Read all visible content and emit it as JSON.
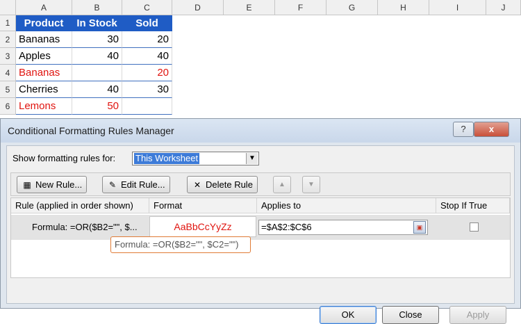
{
  "sheet": {
    "columns": [
      "A",
      "B",
      "C",
      "D",
      "E",
      "F",
      "G",
      "H",
      "I",
      "J"
    ],
    "rows": [
      "1",
      "2",
      "3",
      "4",
      "5",
      "6"
    ],
    "header": {
      "product": "Product",
      "instock": "In Stock",
      "sold": "Sold"
    },
    "data": [
      {
        "product": "Bananas",
        "instock": "30",
        "sold": "20"
      },
      {
        "product": "Apples",
        "instock": "40",
        "sold": "40"
      },
      {
        "product": "Bananas",
        "instock": "",
        "sold": "20"
      },
      {
        "product": "Cherries",
        "instock": "40",
        "sold": "30"
      },
      {
        "product": "Lemons",
        "instock": "50",
        "sold": ""
      }
    ]
  },
  "dialog": {
    "title": "Conditional Formatting Rules Manager",
    "help_label": "?",
    "close_label": "x",
    "show_label": "Show formatting rules for:",
    "show_value": "This Worksheet",
    "toolbar": {
      "new_rule": "New Rule...",
      "edit_rule": "Edit Rule...",
      "delete_rule": "Delete Rule"
    },
    "columns": {
      "rule": "Rule (applied in order shown)",
      "format": "Format",
      "applies": "Applies to",
      "stop": "Stop If True"
    },
    "rule": {
      "formula": "Formula: =OR($B2=\"\", $...",
      "format_preview": "AaBbCcYyZz",
      "applies_to": "=$A$2:$C$6"
    },
    "tooltip": "Formula: =OR($B2=\"\", $C2=\"\")",
    "buttons": {
      "ok": "OK",
      "close": "Close",
      "apply": "Apply"
    }
  },
  "colors": {
    "header_fill": "#1f5cc5",
    "red_text": "#e0140f",
    "tooltip_border": "#e07b35"
  },
  "icons": [
    "new-rule-icon",
    "edit-rule-icon",
    "delete-x-icon",
    "move-up-icon",
    "move-down-icon",
    "range-selector-icon",
    "dropdown-arrow-icon"
  ]
}
